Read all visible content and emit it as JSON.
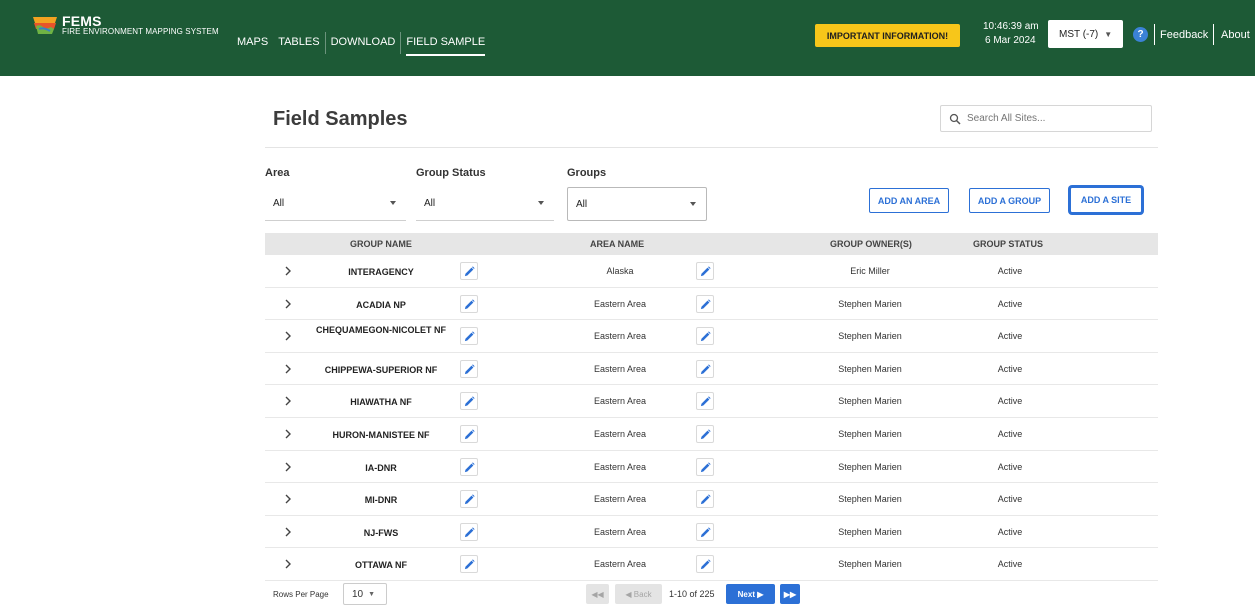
{
  "header": {
    "brand_name": "FEMS",
    "brand_subtitle": "FIRE ENVIRONMENT MAPPING SYSTEM",
    "nav": [
      "MAPS",
      "TABLES",
      "DOWNLOAD",
      "FIELD SAMPLE"
    ],
    "active_nav": "FIELD SAMPLE",
    "important_button": "IMPORTANT INFORMATION!",
    "time": "10:46:39 am",
    "date": "6 Mar 2024",
    "timezone": "MST (-7)",
    "help_icon": "?",
    "feedback": "Feedback",
    "about": "About"
  },
  "page": {
    "title": "Field Samples",
    "search_placeholder": "Search All Sites..."
  },
  "filters": {
    "area": {
      "label": "Area",
      "value": "All"
    },
    "group_status": {
      "label": "Group Status",
      "value": "All"
    },
    "groups": {
      "label": "Groups",
      "value": "All"
    }
  },
  "actions": {
    "add_area": "ADD AN AREA",
    "add_group": "ADD A GROUP",
    "add_site": "ADD A SITE"
  },
  "table": {
    "columns": [
      "GROUP NAME",
      "AREA NAME",
      "GROUP OWNER(S)",
      "GROUP STATUS"
    ],
    "rows": [
      {
        "group": "INTERAGENCY",
        "area": "Alaska",
        "owner": "Eric Miller",
        "status": "Active"
      },
      {
        "group": "ACADIA NP",
        "area": "Eastern Area",
        "owner": "Stephen Marien",
        "status": "Active"
      },
      {
        "group": "CHEQUAMEGON-NICOLET NF",
        "area": "Eastern Area",
        "owner": "Stephen Marien",
        "status": "Active"
      },
      {
        "group": "CHIPPEWA-SUPERIOR NF",
        "area": "Eastern Area",
        "owner": "Stephen Marien",
        "status": "Active"
      },
      {
        "group": "HIAWATHA NF",
        "area": "Eastern Area",
        "owner": "Stephen Marien",
        "status": "Active"
      },
      {
        "group": "HURON-MANISTEE NF",
        "area": "Eastern Area",
        "owner": "Stephen Marien",
        "status": "Active"
      },
      {
        "group": "IA-DNR",
        "area": "Eastern Area",
        "owner": "Stephen Marien",
        "status": "Active"
      },
      {
        "group": "MI-DNR",
        "area": "Eastern Area",
        "owner": "Stephen Marien",
        "status": "Active"
      },
      {
        "group": "NJ-FWS",
        "area": "Eastern Area",
        "owner": "Stephen Marien",
        "status": "Active"
      },
      {
        "group": "OTTAWA NF",
        "area": "Eastern Area",
        "owner": "Stephen Marien",
        "status": "Active"
      }
    ]
  },
  "pagination": {
    "rows_per_page_label": "Rows Per Page",
    "rows_per_page": "10",
    "first_icon": "◀◀",
    "back_label": "◀ Back",
    "range": "1-10 of 225",
    "next_label": "Next ▶",
    "last_icon": "▶▶"
  },
  "colors": {
    "header_bg": "#1d5a36",
    "accent_blue": "#2c70d6",
    "warning_yellow": "#f7c61a"
  }
}
